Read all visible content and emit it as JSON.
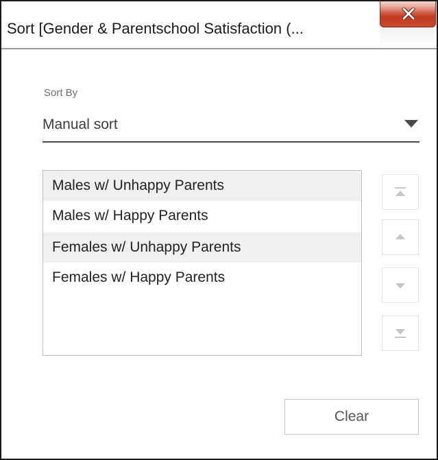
{
  "window": {
    "title": "Sort [Gender & Parentschool Satisfaction (..."
  },
  "sort": {
    "label": "Sort By",
    "selected": "Manual sort"
  },
  "list": {
    "items": [
      {
        "label": "Males w/ Unhappy Parents"
      },
      {
        "label": "Males w/ Happy Parents"
      },
      {
        "label": "Females w/ Unhappy Parents"
      },
      {
        "label": "Females w/ Happy Parents"
      }
    ]
  },
  "buttons": {
    "clear": "Clear"
  },
  "icons": {
    "close": "close-icon",
    "dropdown": "chevron-down-icon",
    "move_top": "move-to-top-icon",
    "move_up": "move-up-icon",
    "move_down": "move-down-icon",
    "move_bottom": "move-to-bottom-icon"
  },
  "colors": {
    "close_button": "#c84a32",
    "selected_row": "#f0f0f0"
  }
}
